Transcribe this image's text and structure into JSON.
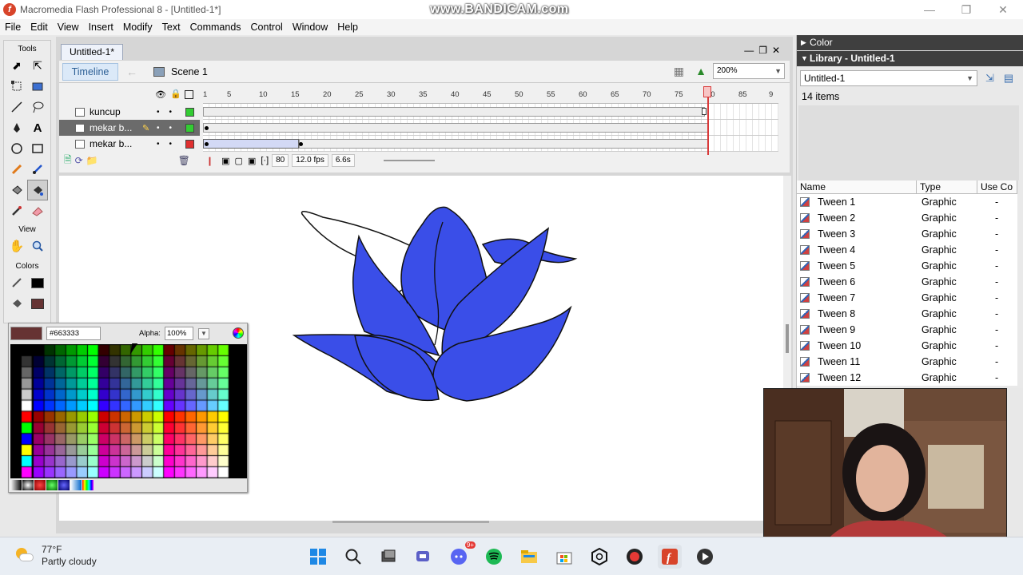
{
  "window": {
    "title": "Macromedia Flash Professional 8 - [Untitled-1*]",
    "watermark": "www.BANDICAM.com"
  },
  "menu": [
    "File",
    "Edit",
    "View",
    "Insert",
    "Modify",
    "Text",
    "Commands",
    "Control",
    "Window",
    "Help"
  ],
  "tools": {
    "section_tools": "Tools",
    "section_view": "View",
    "section_colors": "Colors"
  },
  "document": {
    "tab": "Untitled-1*",
    "timeline_button": "Timeline",
    "scene": "Scene 1",
    "zoom": "200%"
  },
  "timeline": {
    "ruler": [
      "1",
      "5",
      "10",
      "15",
      "20",
      "25",
      "30",
      "35",
      "40",
      "45",
      "50",
      "55",
      "60",
      "65",
      "70",
      "75",
      "80",
      "85",
      "9"
    ],
    "layers": [
      {
        "name": "kuncup",
        "color": "#33cc33"
      },
      {
        "name": "mekar b...",
        "color": "#33cc33"
      },
      {
        "name": "mekar b...",
        "color": "#e03030"
      }
    ],
    "current_frame": "80",
    "fps": "12.0 fps",
    "time": "6.6s"
  },
  "color_picker": {
    "hex": "#663333",
    "alpha_label": "Alpha:",
    "alpha": "100%",
    "selected_color": "#663333"
  },
  "panels": {
    "color_title": "Color",
    "library_title": "Library - Untitled-1",
    "library_doc": "Untitled-1",
    "item_count": "14 items",
    "columns": [
      "Name",
      "Type",
      "Use Co"
    ],
    "items": [
      {
        "name": "Tween 1",
        "type": "Graphic",
        "use": "-"
      },
      {
        "name": "Tween 2",
        "type": "Graphic",
        "use": "-"
      },
      {
        "name": "Tween 3",
        "type": "Graphic",
        "use": "-"
      },
      {
        "name": "Tween 4",
        "type": "Graphic",
        "use": "-"
      },
      {
        "name": "Tween 5",
        "type": "Graphic",
        "use": "-"
      },
      {
        "name": "Tween 6",
        "type": "Graphic",
        "use": "-"
      },
      {
        "name": "Tween 7",
        "type": "Graphic",
        "use": "-"
      },
      {
        "name": "Tween 8",
        "type": "Graphic",
        "use": "-"
      },
      {
        "name": "Tween 9",
        "type": "Graphic",
        "use": "-"
      },
      {
        "name": "Tween 10",
        "type": "Graphic",
        "use": "-"
      },
      {
        "name": "Tween 11",
        "type": "Graphic",
        "use": "-"
      },
      {
        "name": "Tween 12",
        "type": "Graphic",
        "use": "-"
      }
    ]
  },
  "stage": {
    "flower_fill": "#3a4ee8"
  },
  "taskbar": {
    "temperature": "77°F",
    "condition": "Partly cloudy",
    "notification_badge": "9+"
  }
}
